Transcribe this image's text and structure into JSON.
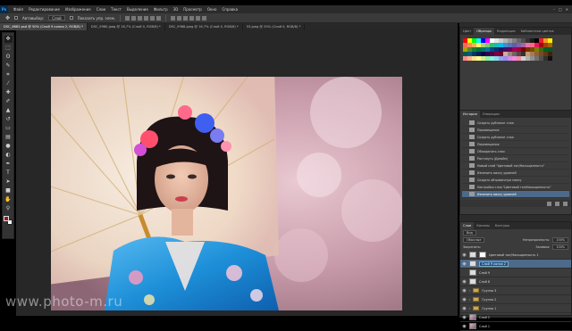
{
  "menubar": {
    "logo": "Ps",
    "items": [
      "Файл",
      "Редактирование",
      "Изображение",
      "Слои",
      "Текст",
      "Выделение",
      "Фильтр",
      "3D",
      "Просмотр",
      "Окно",
      "Справка"
    ],
    "controls": [
      "–",
      "□",
      "✕"
    ]
  },
  "options": {
    "auto_select_label": "Автовыбор:",
    "auto_select_value": "Слой",
    "show_controls_label": "Показать упр. элем."
  },
  "doc_tabs": [
    {
      "label": "DSC_6682.psd @ 50% (Слой 9 копия 2, RGB/8) *",
      "active": true
    },
    {
      "label": "DSC_9980.jpeg @ 16,7% (Слой 0, RGB/8) *",
      "active": false
    },
    {
      "label": "DSC_9988.jpeg @ 16,7% (Слой 0, RGB/8) *",
      "active": false
    },
    {
      "label": "53.jpeg @ 25% (Слой 0, RGB/8) *",
      "active": false
    }
  ],
  "tools": [
    "move",
    "marquee",
    "lasso",
    "quick-select",
    "crop",
    "eyedropper",
    "healing",
    "brush",
    "stamp",
    "history-brush",
    "eraser",
    "gradient",
    "blur",
    "dodge",
    "pen",
    "text",
    "path-select",
    "shape",
    "hand",
    "zoom"
  ],
  "color_panel": {
    "tabs": [
      "Цвет",
      "Образцы",
      "Коррекция",
      "Библиотеки цветов"
    ],
    "active_tab": 1,
    "swatches": [
      "#ff0000",
      "#ffff00",
      "#00ff00",
      "#00ffff",
      "#0000ff",
      "#ff00ff",
      "#ffffff",
      "#e6e6e6",
      "#cccccc",
      "#b3b3b3",
      "#999999",
      "#808080",
      "#666666",
      "#4d4d4d",
      "#333333",
      "#1a1a1a",
      "#000000",
      "#ed1c24",
      "#f7941d",
      "#fff200",
      "#f26c4f",
      "#f68e56",
      "#fbaf5c",
      "#fff467",
      "#acd372",
      "#7cc576",
      "#3bb878",
      "#1abbb4",
      "#00bff3",
      "#438ccb",
      "#5574b9",
      "#605ca8",
      "#855fa8",
      "#a763a8",
      "#f06eaa",
      "#f26d7d",
      "#ed145b",
      "#9e0b0f",
      "#a0410d",
      "#a36209",
      "#aba000",
      "#598527",
      "#1a7b30",
      "#007236",
      "#00746b",
      "#0076a3",
      "#004b80",
      "#003471",
      "#1b1464",
      "#440e62",
      "#630460",
      "#9e005d",
      "#9e0039",
      "#790000",
      "#7b2e00",
      "#7d4900",
      "#827b00",
      "#406618",
      "#005e20",
      "#005826",
      "#005952",
      "#005b7f",
      "#003663",
      "#002157",
      "#0d004c",
      "#32004b",
      "#4b0049",
      "#7b0046",
      "#7a0026",
      "#c7b299",
      "#998675",
      "#736357",
      "#534741",
      "#37302d",
      "#c69c6d",
      "#a67c52",
      "#8c6239",
      "#754c24",
      "#603913",
      "#42210b",
      "#ff8a8a",
      "#ffb38a",
      "#ffe08a",
      "#fffa8a",
      "#c8f08a",
      "#8af0a0",
      "#8af0e0",
      "#8ad8f0",
      "#8aa8f0",
      "#a08af0",
      "#d08af0",
      "#f08ae0",
      "#f08aa8",
      "#d0d0d0",
      "#b0b0b0",
      "#909090",
      "#707070",
      "#505050",
      "#303030",
      "#101010"
    ]
  },
  "history_panel": {
    "tabs": [
      "История",
      "Операции"
    ],
    "items": [
      {
        "label": "Создать дубликат слоя",
        "selected": false
      },
      {
        "label": "Перемещение",
        "selected": false
      },
      {
        "label": "Создать дубликат слоя",
        "selected": false
      },
      {
        "label": "Перемещение",
        "selected": false
      },
      {
        "label": "Объединить слои",
        "selected": false
      },
      {
        "label": "Растянуть (Дизайн)",
        "selected": false
      },
      {
        "label": "Новый слой \"Цветовой тон/Насыщенность\"",
        "selected": false
      },
      {
        "label": "Изменить маску уровней",
        "selected": false
      },
      {
        "label": "Создать обтравочную маску",
        "selected": false
      },
      {
        "label": "Настройки слоя \"Цветовой тон/Насыщенность\"",
        "selected": false
      },
      {
        "label": "Изменить маску уровней",
        "selected": true
      }
    ]
  },
  "layers_panel": {
    "tabs": [
      "Слои",
      "Каналы",
      "Контуры"
    ],
    "kind_label": "Вид",
    "blend_mode": "Обычные",
    "opacity_label": "Непрозрачность:",
    "opacity_value": "100%",
    "lock_label": "Закрепить:",
    "fill_label": "Заливка:",
    "fill_value": "100%",
    "layers": [
      {
        "name": "Цветовой тон/Насыщенность 1",
        "kind": "adjustment",
        "visible": true,
        "selected": false
      },
      {
        "name": "Слой 9 копия 2",
        "kind": "layer",
        "visible": true,
        "selected": true,
        "editing": true
      },
      {
        "name": "Слой 9",
        "kind": "layer",
        "visible": false,
        "selected": false
      },
      {
        "name": "Слой 8",
        "kind": "layer",
        "visible": true,
        "selected": false
      },
      {
        "name": "Группа 3",
        "kind": "group",
        "visible": true,
        "selected": false
      },
      {
        "name": "Группа 2",
        "kind": "group",
        "visible": true,
        "selected": false
      },
      {
        "name": "Группа 1",
        "kind": "group",
        "visible": true,
        "selected": false
      },
      {
        "name": "Слой 2",
        "kind": "photo",
        "visible": true,
        "selected": false
      },
      {
        "name": "Слой 1",
        "kind": "photo",
        "visible": true,
        "selected": false
      }
    ]
  },
  "watermark": "www.photo-m.ru",
  "colors": {
    "fg": "#a01818",
    "bg": "#ffffff",
    "accent": "#4d6a8a"
  }
}
